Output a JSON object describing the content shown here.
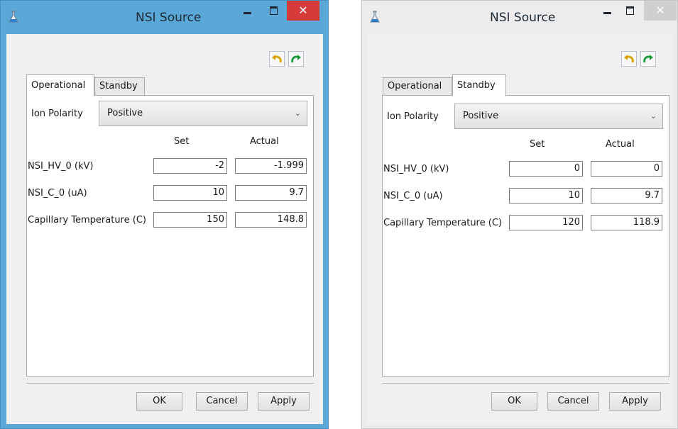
{
  "windows": [
    {
      "title": "NSI Source",
      "controls": {
        "close": "✕"
      },
      "tabs": [
        "Operational",
        "Standby"
      ],
      "active_tab": "Operational",
      "ion_polarity_label": "Ion Polarity",
      "ion_polarity_value": "Positive",
      "col_set": "Set",
      "col_actual": "Actual",
      "rows": [
        {
          "label": "NSI_HV_0 (kV)",
          "set": "-2",
          "actual": "-1.999"
        },
        {
          "label": "NSI_C_0 (uA)",
          "set": "10",
          "actual": "9.7"
        },
        {
          "label": "Capillary Temperature (C)",
          "set": "150",
          "actual": "148.8"
        }
      ],
      "buttons": {
        "ok": "OK",
        "cancel": "Cancel",
        "apply": "Apply"
      },
      "icons": [
        "flask-icon",
        "undo-icon",
        "redo-icon"
      ],
      "accent": "#5aa7d8",
      "close_color": "#d43b38"
    },
    {
      "title": "NSI Source",
      "controls": {
        "close": "✕"
      },
      "tabs": [
        "Operational",
        "Standby"
      ],
      "active_tab": "Standby",
      "ion_polarity_label": "Ion Polarity",
      "ion_polarity_value": "Positive",
      "col_set": "Set",
      "col_actual": "Actual",
      "rows": [
        {
          "label": "NSI_HV_0 (kV)",
          "set": "0",
          "actual": "0"
        },
        {
          "label": "NSI_C_0 (uA)",
          "set": "10",
          "actual": "9.7"
        },
        {
          "label": "Capillary Temperature (C)",
          "set": "120",
          "actual": "118.9"
        }
      ],
      "buttons": {
        "ok": "OK",
        "cancel": "Cancel",
        "apply": "Apply"
      },
      "icons": [
        "flask-icon",
        "undo-icon",
        "redo-icon"
      ],
      "accent": "#ececec",
      "close_color": "#cfcfcf"
    }
  ]
}
